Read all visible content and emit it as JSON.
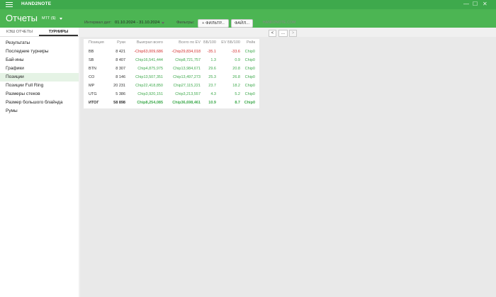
{
  "app": {
    "name": "HAND2NOTE"
  },
  "window_controls": {
    "minimize": "—",
    "maximize": "☐",
    "close": "✕"
  },
  "header": {
    "title": "Отчеты",
    "currency": "МТТ ($)"
  },
  "tabs": [
    {
      "label": "КЭШ ОТЧЕТЫ",
      "active": false
    },
    {
      "label": "ТУРНИРЫ",
      "active": true
    }
  ],
  "menu": [
    "Результаты",
    "Последние турниры",
    "Бай-ины",
    "Графики",
    "Позиции",
    "Позиции Full Ring",
    "Размеры стеков",
    "Размер большого блайнда",
    "Румы"
  ],
  "menu_active_index": 4,
  "toolbar": {
    "interval_label": "Интервал дат:",
    "interval_value": "01.10.2024 - 31.10.2024",
    "filters_label": "Фильтры:",
    "filter_button": "+ ФИЛЬТР...",
    "file_button": "ФАЙЛ...",
    "logo_text": "HAND2NOTE.COM",
    "prev_icon": "chevron-left-icon",
    "next_icon": "chevron-right-icon",
    "more_label": "..."
  },
  "table": {
    "columns": [
      "Позиция",
      "Руки",
      "Выиграл всего",
      "Всего по EV",
      "ББ/100",
      "EV ББ/100",
      "Рейк"
    ],
    "rows": [
      {
        "pos": "BB",
        "hands": "8 421",
        "won": "-Chip63,009,686",
        "ev": "-Chip29,834,018",
        "bb100": "-35.1",
        "evbb100": "-33.6",
        "rake": "Chip0"
      },
      {
        "pos": "SB",
        "hands": "8 407",
        "won": "Chip16,541,444",
        "ev": "Chip8,721,757",
        "bb100": "1.3",
        "evbb100": "0.9",
        "rake": "Chip0"
      },
      {
        "pos": "BTN",
        "hands": "8 307",
        "won": "Chip4,875,975",
        "ev": "Chip13,984,671",
        "bb100": "29.6",
        "evbb100": "20.8",
        "rake": "Chip0"
      },
      {
        "pos": "CO",
        "hands": "8 146",
        "won": "Chip13,507,351",
        "ev": "Chip13,497,273",
        "bb100": "25.3",
        "evbb100": "26.8",
        "rake": "Chip0"
      },
      {
        "pos": "MP",
        "hands": "20 231",
        "won": "Chip22,418,850",
        "ev": "Chip27,115,221",
        "bb100": "23.7",
        "evbb100": "18.2",
        "rake": "Chip0"
      },
      {
        "pos": "UTG",
        "hands": "5 386",
        "won": "Chip3,920,151",
        "ev": "Chip3,213,557",
        "bb100": "4.3",
        "evbb100": "5.2",
        "rake": "Chip0"
      }
    ],
    "total": {
      "pos": "ИТОГ",
      "hands": "58 898",
      "won": "Chip8,254,085",
      "ev": "Chip36,698,461",
      "bb100": "10.9",
      "evbb100": "8.7",
      "rake": "Chip0"
    }
  },
  "colors": {
    "accent": "#4cb553",
    "titlebar": "#3ea94c",
    "negative": "#d32f2f",
    "positive": "#3ea94c"
  }
}
